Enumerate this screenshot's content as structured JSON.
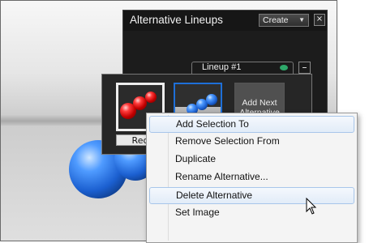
{
  "panel": {
    "title": "Alternative Lineups",
    "create_label": "Create",
    "close_symbol": "×"
  },
  "lineup": {
    "name": "Lineup #1",
    "collapse_symbol": "–",
    "thumbnails": [
      {
        "label": "Red",
        "selected": false
      },
      {
        "label": "",
        "selected": true
      }
    ],
    "add_next_label": "Add Next Alternative"
  },
  "context_menu": {
    "items": [
      {
        "label": "Add Selection To",
        "highlighted": true
      },
      {
        "label": "Remove Selection From",
        "highlighted": false
      },
      {
        "label": "Duplicate",
        "highlighted": false
      },
      {
        "label": "Rename Alternative...",
        "highlighted": false
      },
      {
        "label": "Delete Alternative",
        "highlighted": true
      },
      {
        "label": "Set Image",
        "highlighted": false
      }
    ]
  },
  "icons": {
    "eye": "eye-icon",
    "dropdown": "chevron-down-icon",
    "close": "close-icon",
    "cursor": "mouse-pointer-icon"
  },
  "colors": {
    "selection_border": "#1e6fd8",
    "menu_highlight": "#a8c6ea",
    "eye_icon": "#2ea86a"
  }
}
